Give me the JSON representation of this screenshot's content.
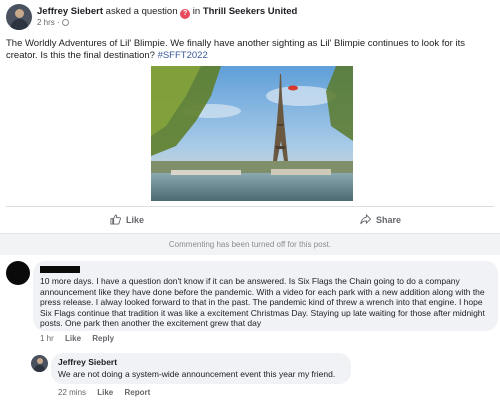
{
  "post": {
    "author": "Jeffrey Siebert",
    "verb": "asked a question",
    "group_connector": "in",
    "group": "Thrill Seekers United",
    "question_icon": "question-icon",
    "time": "2 hrs",
    "separator": "·",
    "privacy_icon": "globe-icon",
    "text": "The Worldly Adventures of Lil' Blimpie. We finally have another sighting as Lil' Blimpie continues to look for its creator. Is this the final destination?",
    "hashtag": "#SFFT2022",
    "image_alt_subject": "Eiffel Tower with small red blimp"
  },
  "actions": {
    "like_label": "Like",
    "share_label": "Share",
    "like_icon": "thumbs-up-icon",
    "share_icon": "share-arrow-icon"
  },
  "disabled_notice": "Commenting has been turned off for this post.",
  "comment": {
    "text": "10 more days. I have a question don't know if it can be answered. Is Six Flags the Chain going to do a company announcement like they have done before the pandemic. With a video for each park with a new addition along with the press release. I alway looked forward to that in the past. The pandemic kind of threw a wrench into that engine. I hope Six Flags continue that tradition it was like a excitement Christmas Day. Staying up late waiting for those after midnight posts. One park then another the excitement grew that day",
    "time": "1 hr",
    "like_label": "Like",
    "reply_label": "Reply"
  },
  "reply": {
    "author": "Jeffrey Siebert",
    "text": "We are not doing a system-wide announcement event this year my friend.",
    "time": "22 mins",
    "like_label": "Like",
    "reply_label": "Report"
  },
  "colors": {
    "hashtag": "#385898",
    "bubble": "#f0f2f5",
    "muted": "#65676b"
  }
}
